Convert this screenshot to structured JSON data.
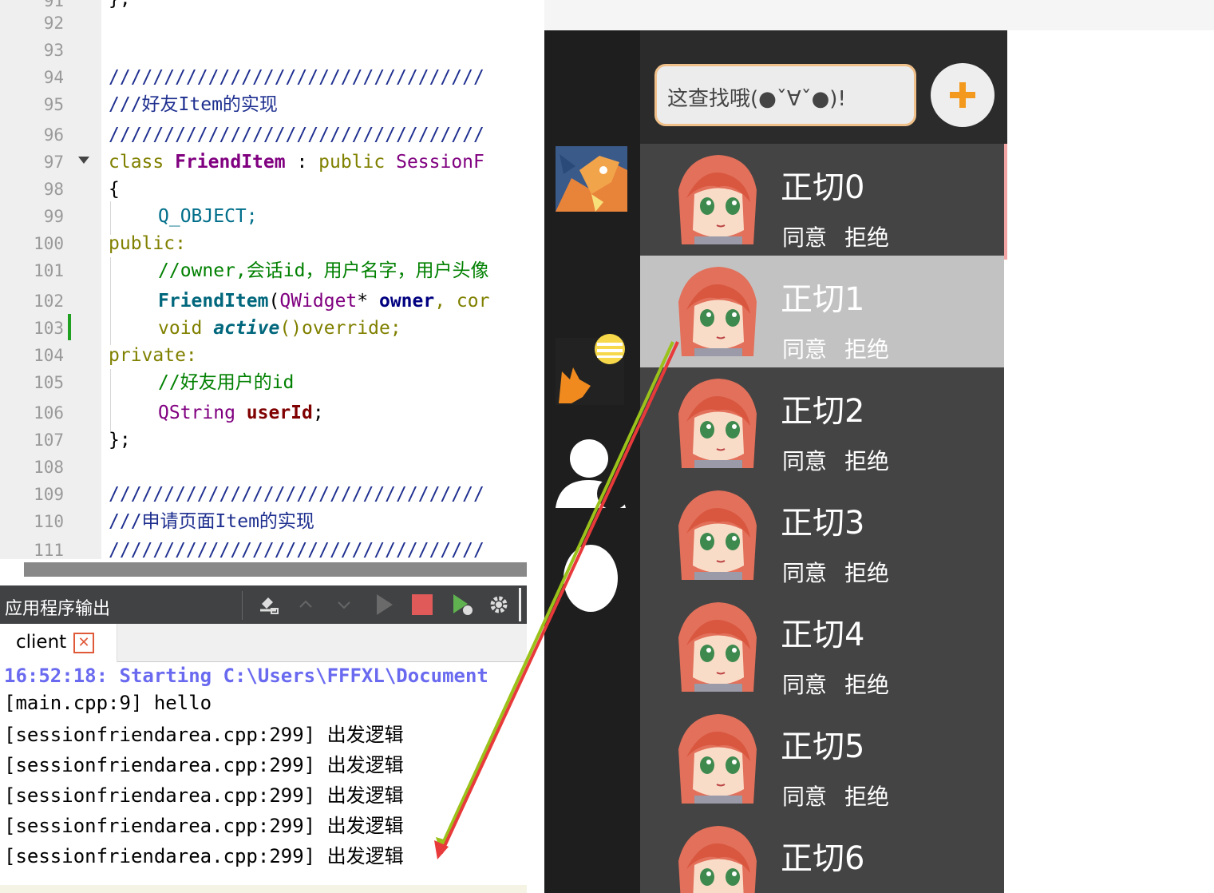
{
  "editor": {
    "line_numbers": [
      "92",
      "93",
      "94",
      "95",
      "96",
      "97",
      "98",
      "99",
      "100",
      "101",
      "102",
      "103",
      "104",
      "105",
      "106",
      "107",
      "108",
      "109",
      "110",
      "111"
    ],
    "slash_line": "//////////////////////////////////",
    "comment_friend": "///好友Item的实现",
    "class_kw": "class",
    "class_name": "FriendItem",
    "class_colon": " : ",
    "public_kw": "public",
    "base_class": "SessionF",
    "brace_open": "{",
    "q_object": "Q_OBJECT;",
    "public_label": "public:",
    "comment_params": "//owner,会话id，用户名字，用户头像",
    "ctor_name": "FriendItem",
    "ctor_p1": "(",
    "ctor_type": "QWidget",
    "ctor_star": "* ",
    "ctor_owner": "owner",
    "ctor_rest": ", cor",
    "void_kw": "void ",
    "active_fn": "active",
    "active_rest": "()override;",
    "private_label": "private:",
    "comment_userid": "//好友用户的id",
    "qstring": "QString ",
    "userid": "userId",
    "semi": ";",
    "brace_close": "};",
    "comment_apply": "///申请页面Item的实现",
    "top_partial": "};"
  },
  "output": {
    "title": "应用程序输出",
    "tab": "client",
    "lines": [
      "16:52:18: Starting C:\\Users\\FFFXL\\Document",
      "[main.cpp:9] hello",
      "[sessionfriendarea.cpp:299] 出发逻辑",
      "[sessionfriendarea.cpp:299] 出发逻辑",
      "[sessionfriendarea.cpp:299] 出发逻辑",
      "[sessionfriendarea.cpp:299] 出发逻辑",
      "[sessionfriendarea.cpp:299] 出发逻辑"
    ]
  },
  "app": {
    "search_placeholder": "这查找哦(●ˇ∀ˇ●)!",
    "add_icon": "plus-icon",
    "items": [
      {
        "name": "正切0",
        "agree": "同意",
        "reject": "拒绝"
      },
      {
        "name": "正切1",
        "agree": "同意",
        "reject": "拒绝"
      },
      {
        "name": "正切2",
        "agree": "同意",
        "reject": "拒绝"
      },
      {
        "name": "正切3",
        "agree": "同意",
        "reject": "拒绝"
      },
      {
        "name": "正切4",
        "agree": "同意",
        "reject": "拒绝"
      },
      {
        "name": "正切5",
        "agree": "同意",
        "reject": "拒绝"
      },
      {
        "name": "正切6",
        "agree": "同意",
        "reject": "拒绝"
      }
    ],
    "selected_index": 1
  },
  "colors": {
    "sidebar": "#1e1e1e",
    "list_bg": "#444444",
    "selected_bg": "#c2c2c2",
    "search_border": "#f0c08a",
    "plus": "#f39a1e",
    "arrow_red": "#e83a3a",
    "arrow_green": "#9bc21a"
  }
}
